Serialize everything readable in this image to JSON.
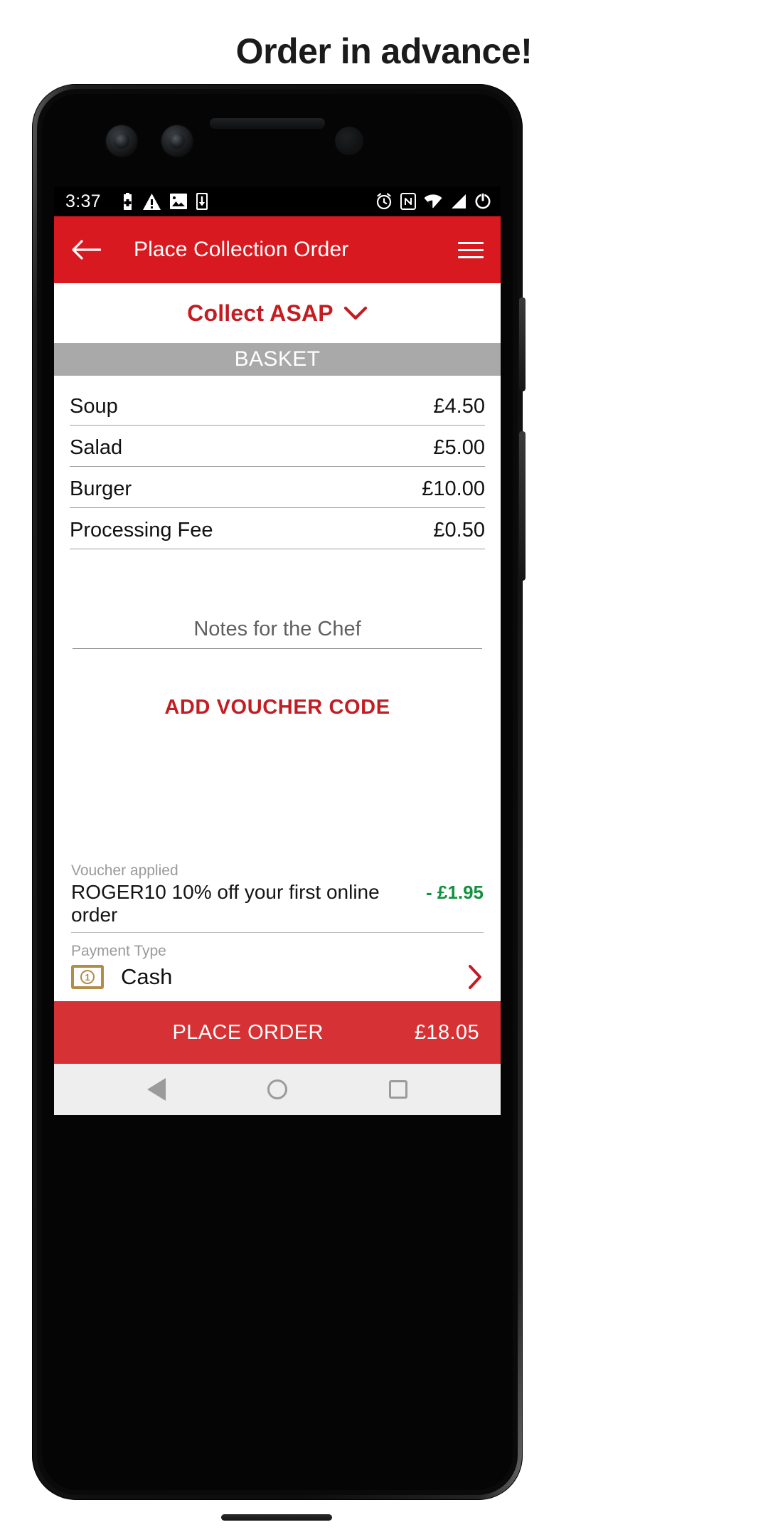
{
  "headline": "Order in advance!",
  "statusbar": {
    "time": "3:37",
    "left_icons": [
      "battery-plus-icon",
      "warning-triangle-icon",
      "image-icon",
      "phone-download-icon"
    ],
    "right_icons": [
      "alarm-icon",
      "nfc-icon",
      "wifi-icon",
      "signal-icon",
      "battery-icon"
    ]
  },
  "appbar": {
    "back_icon": "back-arrow-icon",
    "title": "Place Collection Order",
    "menu_icon": "hamburger-menu-icon",
    "background": "#d81920"
  },
  "collect": {
    "label": "Collect ASAP",
    "chevron_icon": "chevron-down-icon",
    "color": "#c21d23"
  },
  "basket": {
    "header": "BASKET",
    "header_background": "#a9a9a9",
    "items": [
      {
        "name": "Soup",
        "price": "£4.50"
      },
      {
        "name": "Salad",
        "price": "£5.00"
      },
      {
        "name": "Burger",
        "price": "£10.00"
      },
      {
        "name": "Processing Fee",
        "price": "£0.50"
      }
    ]
  },
  "notes": {
    "placeholder": "Notes for the Chef",
    "value": ""
  },
  "voucher_cta": {
    "label": "ADD VOUCHER CODE",
    "color": "#c21d23"
  },
  "voucher_applied": {
    "caption": "Voucher applied",
    "description": "ROGER10 10% off your first online order",
    "amount": "- £1.95",
    "amount_color": "#12913f"
  },
  "payment": {
    "caption": "Payment Type",
    "icon": "cash-banknote-icon",
    "coin_label": "1",
    "value": "Cash",
    "chevron_icon": "chevron-right-icon"
  },
  "place_order": {
    "label": "PLACE ORDER",
    "total": "£18.05",
    "background": "#d63235"
  },
  "navbar": {
    "back_icon": "nav-back-icon",
    "home_icon": "nav-home-icon",
    "recent_icon": "nav-recent-icon"
  }
}
